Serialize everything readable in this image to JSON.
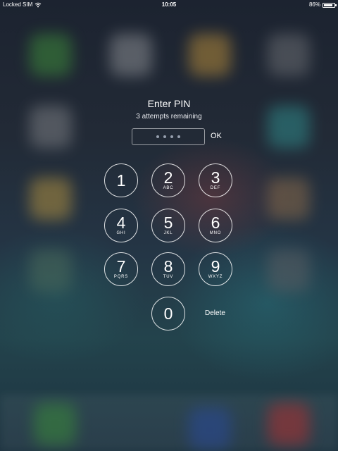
{
  "status_bar": {
    "carrier": "Locked SIM",
    "time": "10:05",
    "battery_percent": "86%",
    "battery_level": 0.86,
    "wifi_icon": "wifi-icon",
    "battery_icon": "battery-icon"
  },
  "pin_entry": {
    "title": "Enter PIN",
    "subtitle": "3 attempts remaining",
    "entered_digits": 4,
    "ok_label": "OK"
  },
  "keypad": {
    "keys": [
      {
        "digit": "1",
        "letters": ""
      },
      {
        "digit": "2",
        "letters": "ABC"
      },
      {
        "digit": "3",
        "letters": "DEF"
      },
      {
        "digit": "4",
        "letters": "GHI"
      },
      {
        "digit": "5",
        "letters": "JKL"
      },
      {
        "digit": "6",
        "letters": "MNO"
      },
      {
        "digit": "7",
        "letters": "PQRS"
      },
      {
        "digit": "8",
        "letters": "TUV"
      },
      {
        "digit": "9",
        "letters": "WXYZ"
      },
      {
        "digit": "0",
        "letters": ""
      }
    ],
    "delete_label": "Delete"
  }
}
